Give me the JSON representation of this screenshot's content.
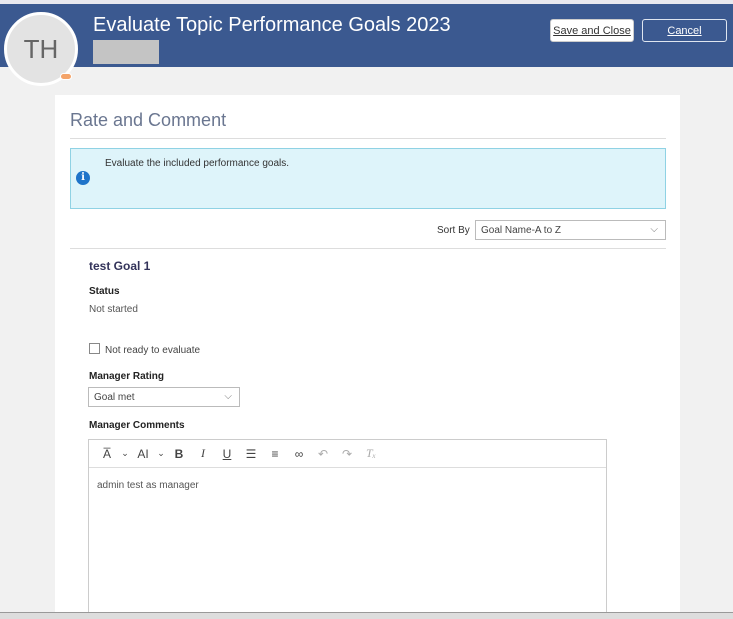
{
  "header": {
    "title": "Evaluate Topic Performance Goals 2023",
    "avatar_initials": "TH",
    "save_label": "Save and Close",
    "cancel_label": "Cancel"
  },
  "section": {
    "title": "Rate and Comment",
    "info": "Evaluate the included performance goals.",
    "sort_label": "Sort By",
    "sort_value": "Goal Name-A to Z"
  },
  "goal": {
    "name": "test Goal 1",
    "status_label": "Status",
    "status_value": "Not started",
    "not_ready_label": "Not ready to evaluate",
    "rating_label": "Manager Rating",
    "rating_value": "Goal met",
    "comments_label": "Manager Comments",
    "comments_value": "admin test as manager"
  },
  "toolbar": {
    "font": "A̅",
    "size": "AΙ",
    "bold": "B",
    "italic": "I",
    "underline": "U",
    "ol": "☰",
    "ul": "≡",
    "link": "∞",
    "undo": "↶",
    "redo": "↷",
    "clear": "Tₓ"
  }
}
